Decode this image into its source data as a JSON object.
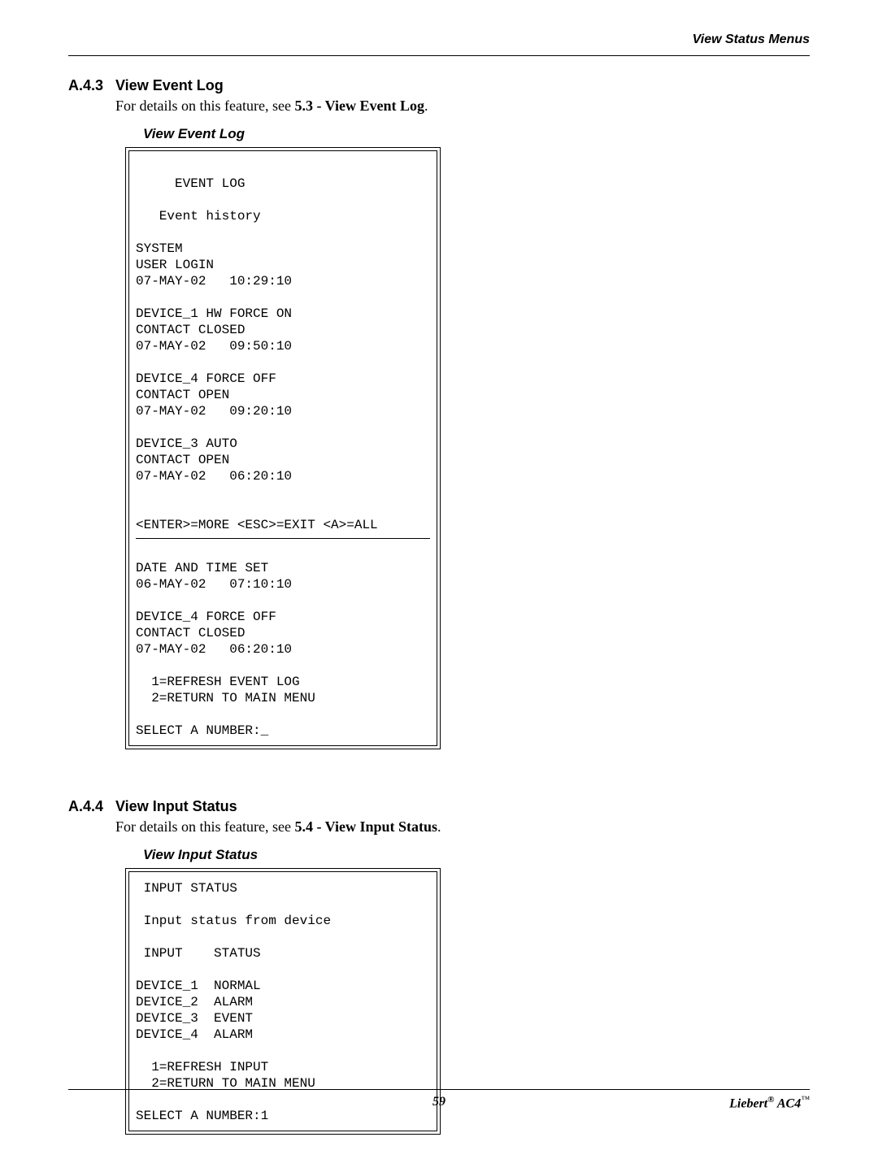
{
  "header": {
    "right": "View Status Menus"
  },
  "sections": {
    "a43": {
      "num": "A.4.3",
      "title": "View Event Log",
      "intro_prefix": "For details on this feature, see ",
      "intro_ref": "5.3 - View Event Log",
      "intro_suffix": "."
    },
    "a44": {
      "num": "A.4.4",
      "title": "View Input Status",
      "intro_prefix": "For details on this feature, see ",
      "intro_ref": "5.4 - View Input Status",
      "intro_suffix": "."
    }
  },
  "event_log": {
    "box_title": "View Event Log",
    "header": "     EVENT LOG",
    "subtitle": "   Event history",
    "entries_top": "SYSTEM\nUSER LOGIN\n07-MAY-02   10:29:10\n\nDEVICE_1 HW FORCE ON\nCONTACT CLOSED\n07-MAY-02   09:50:10\n\nDEVICE_4 FORCE OFF\nCONTACT OPEN\n07-MAY-02   09:20:10\n\nDEVICE_3 AUTO\nCONTACT OPEN\n07-MAY-02   06:20:10\n\n\n<ENTER>=MORE <ESC>=EXIT <A>=ALL",
    "entries_bottom": "DATE AND TIME SET\n06-MAY-02   07:10:10\n\nDEVICE_4 FORCE OFF\nCONTACT CLOSED\n07-MAY-02   06:20:10\n\n  1=REFRESH EVENT LOG\n  2=RETURN TO MAIN MENU\n\nSELECT A NUMBER:_"
  },
  "input_status": {
    "box_title": "View Input Status",
    "body": " INPUT STATUS\n\n Input status from device\n\n INPUT    STATUS\n\nDEVICE_1  NORMAL\nDEVICE_2  ALARM\nDEVICE_3  EVENT\nDEVICE_4  ALARM\n\n  1=REFRESH INPUT\n  2=RETURN TO MAIN MENU\n\nSELECT A NUMBER:1"
  },
  "footer": {
    "page": "59",
    "brand_pre": "Liebert",
    "reg": "®",
    "brand_post": " AC4",
    "tm": "™"
  }
}
